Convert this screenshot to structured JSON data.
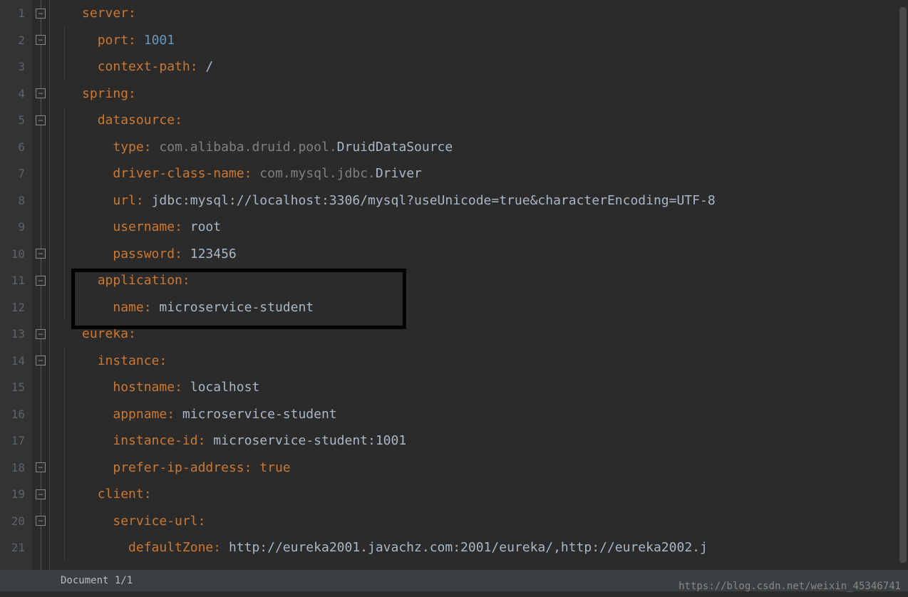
{
  "line_numbers": [
    "1",
    "2",
    "3",
    "4",
    "5",
    "6",
    "7",
    "8",
    "9",
    "10",
    "11",
    "12",
    "13",
    "14",
    "15",
    "16",
    "17",
    "18",
    "19",
    "20",
    "21"
  ],
  "code": {
    "l1": {
      "indent": "",
      "key": "server",
      "colon": ":",
      "val": ""
    },
    "l2": {
      "indent": "  ",
      "key": "port",
      "colon": ": ",
      "val": "1001"
    },
    "l3": {
      "indent": "  ",
      "key": "context-path",
      "colon": ": ",
      "val": "/"
    },
    "l4": {
      "indent": "",
      "key": "spring",
      "colon": ":",
      "val": ""
    },
    "l5": {
      "indent": "  ",
      "key": "datasource",
      "colon": ":",
      "val": ""
    },
    "l6": {
      "indent": "    ",
      "key": "type",
      "colon": ": ",
      "pkg": "com.alibaba.druid.pool.",
      "cls": "DruidDataSource"
    },
    "l7": {
      "indent": "    ",
      "key": "driver-class-name",
      "colon": ": ",
      "pkg": "com.mysql.jdbc.",
      "cls": "Driver"
    },
    "l8": {
      "indent": "    ",
      "key": "url",
      "colon": ": ",
      "val": "jdbc:mysql://localhost:3306/mysql?useUnicode=true&characterEncoding=UTF-8"
    },
    "l9": {
      "indent": "    ",
      "key": "username",
      "colon": ": ",
      "val": "root"
    },
    "l10": {
      "indent": "    ",
      "key": "password",
      "colon": ": ",
      "val": "123456"
    },
    "l11": {
      "indent": "  ",
      "key": "application",
      "colon": ":",
      "val": ""
    },
    "l12": {
      "indent": "    ",
      "key": "name",
      "colon": ": ",
      "val": "microservice-student"
    },
    "l13": {
      "indent": "",
      "key": "eureka",
      "colon": ":",
      "val": ""
    },
    "l14": {
      "indent": "  ",
      "key": "instance",
      "colon": ":",
      "val": ""
    },
    "l15": {
      "indent": "    ",
      "key": "hostname",
      "colon": ": ",
      "val": "localhost"
    },
    "l16": {
      "indent": "    ",
      "key": "appname",
      "colon": ": ",
      "val": "microservice-student"
    },
    "l17": {
      "indent": "    ",
      "key": "instance-id",
      "colon": ": ",
      "val": "microservice-student:1001"
    },
    "l18": {
      "indent": "    ",
      "key": "prefer-ip-address",
      "colon": ": ",
      "val": "true"
    },
    "l19": {
      "indent": "  ",
      "key": "client",
      "colon": ":",
      "val": ""
    },
    "l20": {
      "indent": "    ",
      "key": "service-url",
      "colon": ":",
      "val": ""
    },
    "l21": {
      "indent": "      ",
      "key": "defaultZone",
      "colon": ": ",
      "val": "http://eureka2001.javachz.com:2001/eureka/,http://eureka2002.j"
    }
  },
  "status": {
    "doc": "Document 1/1"
  },
  "watermark": "https://blog.csdn.net/weixin_45346741",
  "fold_positions": [
    0,
    1,
    3,
    4,
    9,
    10,
    12,
    13,
    17,
    18,
    19
  ]
}
